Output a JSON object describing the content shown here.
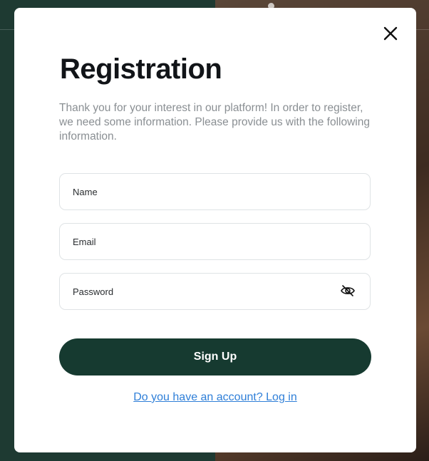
{
  "modal": {
    "title": "Registration",
    "description": "Thank you for your interest in our platform! In order to register, we need some information. Please provide us with the following information.",
    "close_icon": "close-icon"
  },
  "form": {
    "name_placeholder": "Name",
    "email_placeholder": "Email",
    "password_placeholder": "Password",
    "password_toggle_icon": "eye-off-icon",
    "submit_label": "Sign Up",
    "login_link_label": "Do you have an account? Log in"
  },
  "colors": {
    "primary": "#163a30",
    "link": "#2f7fd8",
    "title": "#111418",
    "description": "#8a8f93"
  }
}
